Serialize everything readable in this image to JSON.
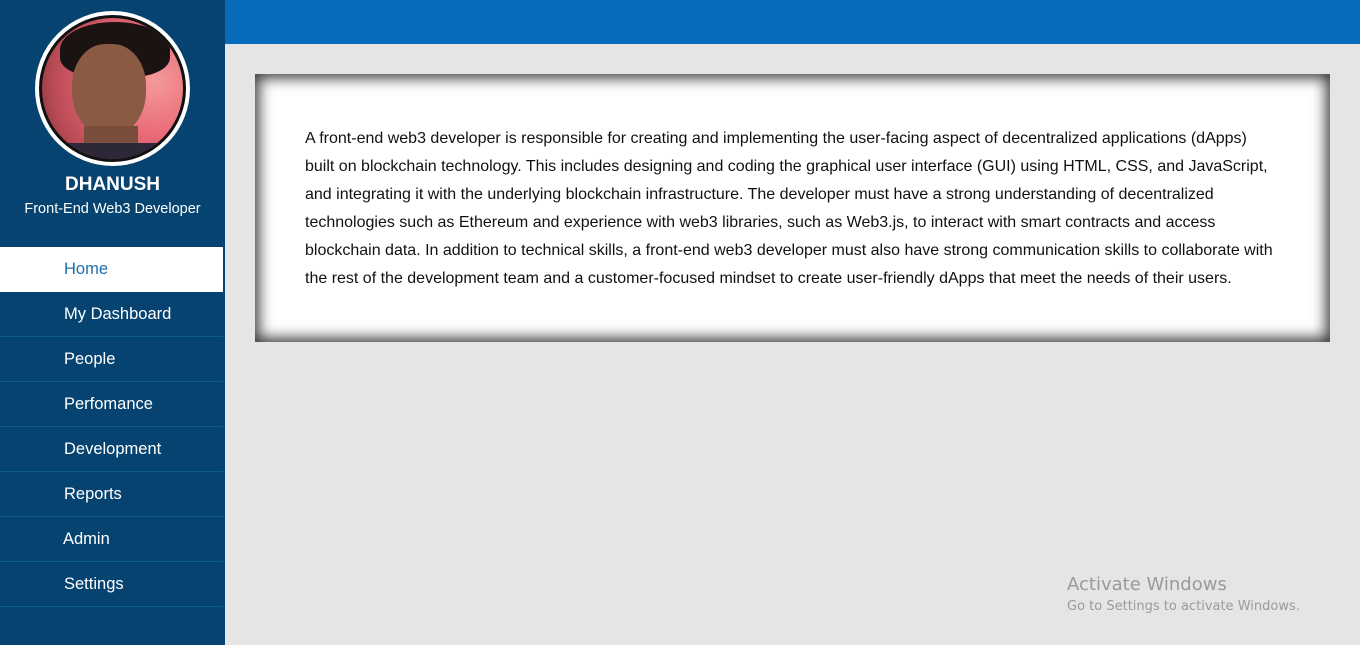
{
  "profile": {
    "name": "DHANUSH",
    "role": "Front-End Web3 Developer"
  },
  "sidebar": {
    "items": [
      {
        "label": "Home",
        "active": true
      },
      {
        "label": "My Dashboard",
        "active": false
      },
      {
        "label": "People",
        "active": false
      },
      {
        "label": "Perfomance",
        "active": false
      },
      {
        "label": "Development",
        "active": false
      },
      {
        "label": "Reports",
        "active": false
      },
      {
        "label": "Admin",
        "active": false
      },
      {
        "label": "Settings",
        "active": false
      }
    ]
  },
  "main": {
    "description": "A front-end web3 developer is responsible for creating and implementing the user-facing aspect of decentralized applications (dApps) built on blockchain technology. This includes designing and coding the graphical user interface (GUI) using HTML, CSS, and JavaScript, and integrating it with the underlying blockchain infrastructure. The developer must have a strong understanding of decentralized technologies such as Ethereum and experience with web3 libraries, such as Web3.js, to interact with smart contracts and access blockchain data. In addition to technical skills, a front-end web3 developer must also have strong communication skills to collaborate with the rest of the development team and a customer-focused mindset to create user-friendly dApps that meet the needs of their users."
  },
  "watermark": {
    "title": "Activate Windows",
    "subtitle": "Go to Settings to activate Windows."
  },
  "colors": {
    "sidebar": "#064370",
    "topbar": "#066bbb",
    "active_text": "#1d6fa8",
    "background": "#e5e5e5"
  }
}
